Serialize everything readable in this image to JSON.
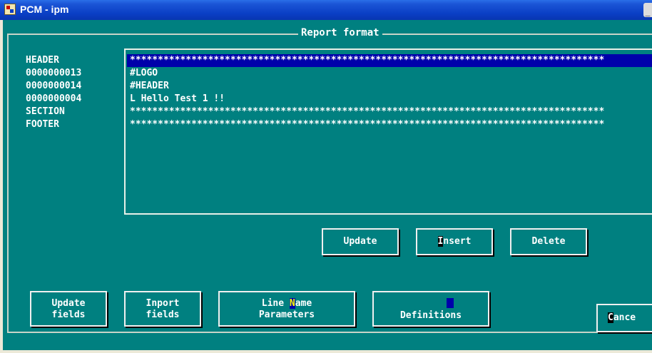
{
  "window": {
    "title": "PCM - ipm",
    "minimize": "_"
  },
  "frame": {
    "title": "Report format"
  },
  "labels": [
    "HEADER",
    "0000000013",
    "0000000014",
    "0000000004",
    "SECTION",
    "FOOTER"
  ],
  "lines": [
    "*************************************************************************************",
    "#LOGO",
    "#HEADER",
    "L Hello Test 1 !!",
    "*************************************************************************************",
    "*************************************************************************************"
  ],
  "buttons": {
    "update": "Update",
    "insert_hot": "I",
    "insert_rest": "nsert",
    "delete": "Delete",
    "update_fields_1": "Update",
    "update_fields_2": "fields",
    "import_fields_1": "Inport",
    "import_fields_2": "fields",
    "line_name_1a": "Line ",
    "line_name_hot": "N",
    "line_name_1b": "ame",
    "line_name_2": "Parameters",
    "definitions": "Definitions",
    "cancel_hot": "C",
    "cancel_rest": "ance"
  }
}
